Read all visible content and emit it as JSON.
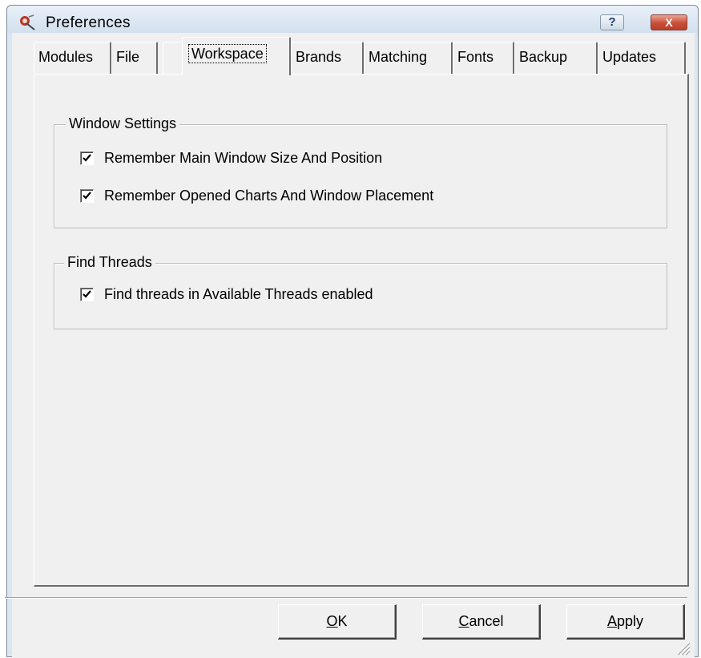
{
  "window": {
    "title": "Preferences",
    "help_label": "?",
    "close_label": "X"
  },
  "tabs": [
    {
      "label": "Modules",
      "active": false
    },
    {
      "label": "File",
      "active": false
    },
    {
      "label": "Workspace",
      "active": true
    },
    {
      "label": "Brands",
      "active": false
    },
    {
      "label": "Matching",
      "active": false
    },
    {
      "label": "Fonts",
      "active": false
    },
    {
      "label": "Backup",
      "active": false
    },
    {
      "label": "Updates",
      "active": false
    }
  ],
  "groups": {
    "window_settings": {
      "title": "Window Settings",
      "options": [
        {
          "label": "Remember Main Window Size And Position",
          "checked": true
        },
        {
          "label": "Remember Opened Charts And Window Placement",
          "checked": true
        }
      ]
    },
    "find_threads": {
      "title": "Find Threads",
      "options": [
        {
          "label": "Find threads in Available Threads enabled",
          "checked": true
        }
      ]
    }
  },
  "buttons": {
    "ok": {
      "mnemonic": "O",
      "rest": "K"
    },
    "cancel": {
      "mnemonic": "C",
      "rest": "ancel"
    },
    "apply": {
      "mnemonic": "A",
      "rest": "pply"
    }
  },
  "colors": {
    "dialog_bg": "#f0f0f0",
    "titlebar": "#d3e0ee",
    "close_button": "#c84e38"
  }
}
